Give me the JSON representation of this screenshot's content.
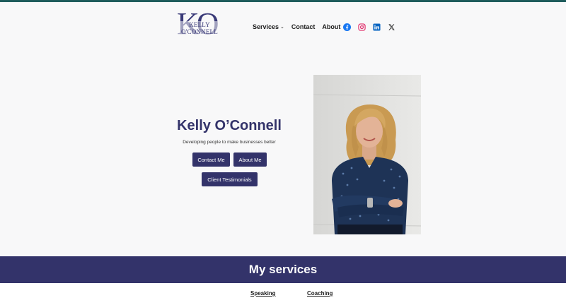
{
  "header": {
    "logo_monogram": "KO",
    "logo_name": "KELLY O'CONNELL",
    "nav": [
      {
        "label": "Services",
        "has_dropdown": true
      },
      {
        "label": "Contact"
      },
      {
        "label": "About"
      }
    ],
    "socials": [
      "facebook-icon",
      "instagram-icon",
      "linkedin-icon",
      "x-icon"
    ]
  },
  "hero": {
    "title": "Kelly O’Connell",
    "subtitle": "Developing people to make businesses better",
    "buttons": {
      "contact": "Contact Me",
      "about": "About Me",
      "testimonials": "Client Testimonials"
    }
  },
  "services": {
    "heading": "My services",
    "links": [
      "Speaking",
      "Coaching"
    ]
  },
  "colors": {
    "brand": "#33336a",
    "top_line": "#1f5c5c",
    "background": "#f8f8f9",
    "facebook": "#1877f2",
    "instagram": "#e1306c",
    "linkedin": "#0a66c2"
  }
}
